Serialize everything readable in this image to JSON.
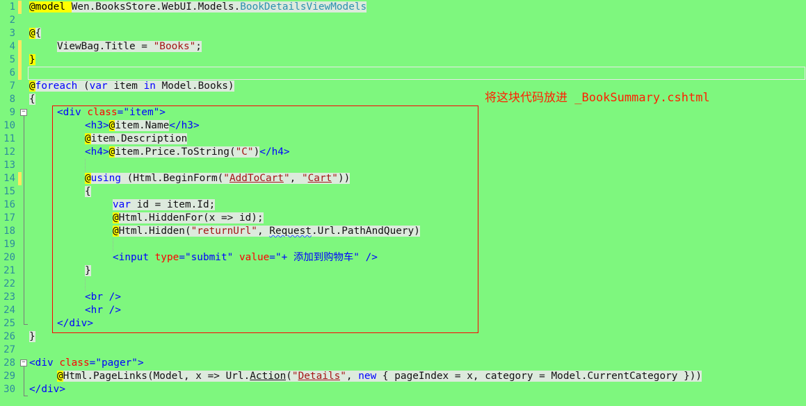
{
  "editor": {
    "line_numbers": [
      "1",
      "2",
      "3",
      "4",
      "5",
      "6",
      "7",
      "8",
      "9",
      "10",
      "11",
      "12",
      "13",
      "14",
      "15",
      "16",
      "17",
      "18",
      "19",
      "20",
      "21",
      "22",
      "23",
      "24",
      "25",
      "26",
      "27",
      "28",
      "29",
      "30"
    ],
    "annotation": "将这块代码放进 _BookSummary.cshtml",
    "lines": {
      "l1": [
        "@model ",
        "Wen.BooksStore.WebUI.Models.",
        "BookDetailsViewModels"
      ],
      "l3": [
        "@",
        "{"
      ],
      "l4": [
        "ViewBag.Title = ",
        "\"Books\"",
        ";"
      ],
      "l5": [
        "}"
      ],
      "l7": [
        "@",
        "foreach",
        " (",
        "var",
        " item ",
        "in",
        " Model.Books)"
      ],
      "l8": [
        "{"
      ],
      "l9": [
        "<div",
        " class",
        "=",
        "\"item\"",
        ">"
      ],
      "l10": [
        "<h3>",
        "@",
        "item.Name",
        "</h3>"
      ],
      "l11": [
        "@",
        "item.Description"
      ],
      "l12": [
        "<h4>",
        "@",
        "item.Price.ToString(",
        "\"C\"",
        ")",
        "</h4>"
      ],
      "l14": [
        "@",
        "using",
        " (Html.BeginForm(",
        "\"",
        "AddToCart",
        "\"",
        ", ",
        "\"",
        "Cart",
        "\"",
        "))"
      ],
      "l15": [
        "{"
      ],
      "l16": [
        "var",
        " id = item.Id;"
      ],
      "l17": [
        "@",
        "Html.HiddenFor(x => id);"
      ],
      "l18": [
        "@",
        "Html.Hidden(",
        "\"returnUrl\"",
        ", ",
        "Request",
        ".Url.PathAndQuery)"
      ],
      "l20": [
        "<input",
        " type",
        "=",
        "\"submit\"",
        " value",
        "=",
        "\"+ 添加到购物车\"",
        " />"
      ],
      "l21": [
        "}"
      ],
      "l23": [
        "<br",
        " />"
      ],
      "l24": [
        "<hr",
        " />"
      ],
      "l25": [
        "</div>"
      ],
      "l26": [
        "}"
      ],
      "l28": [
        "<div",
        " class",
        "=",
        "\"pager\"",
        ">"
      ],
      "l29": [
        "@",
        "Html.PageLinks(Model, x => Url.",
        "Action",
        "(",
        "\"",
        "Details",
        "\"",
        ", ",
        "new",
        " { pageIndex = x, category = Model.CurrentCategory }))"
      ],
      "l30": [
        "</div>"
      ]
    }
  }
}
